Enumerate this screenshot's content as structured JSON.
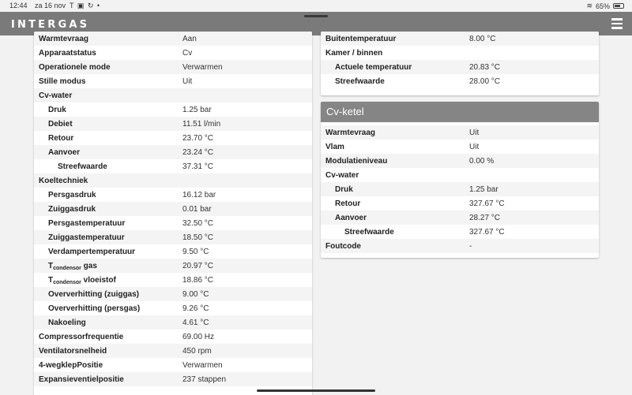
{
  "status": {
    "time": "12:44",
    "date": "za 16 nov",
    "notifications": "T ▣ ↻ •",
    "battery": "65%",
    "battery_level": 0.65
  },
  "app": {
    "logo": "INTERGAS"
  },
  "left_card": {
    "rows": [
      {
        "label": "Warmtevraag",
        "value": "Aan",
        "level": 0
      },
      {
        "label": "Apparaatstatus",
        "value": "Cv",
        "level": 0
      },
      {
        "label": "Operationele mode",
        "value": "Verwarmen",
        "level": 0
      },
      {
        "label": "Stille modus",
        "value": "Uit",
        "level": 0
      },
      {
        "label": "Cv-water",
        "value": "",
        "level": 0
      },
      {
        "label": "Druk",
        "value": "1.25 bar",
        "level": 1
      },
      {
        "label": "Debiet",
        "value": "11.51 l/min",
        "level": 1
      },
      {
        "label": "Retour",
        "value": "23.70 °C",
        "level": 1
      },
      {
        "label": "Aanvoer",
        "value": "23.24 °C",
        "level": 1
      },
      {
        "label": "Streefwaarde",
        "value": "37.31 °C",
        "level": 2
      },
      {
        "label": "Koeltechniek",
        "value": "",
        "level": 0
      },
      {
        "label": "Persgasdruk",
        "value": "16.12 bar",
        "level": 1
      },
      {
        "label": "Zuiggasdruk",
        "value": "0.01 bar",
        "level": 1
      },
      {
        "label": "Persgastemperatuur",
        "value": "32.50 °C",
        "level": 1
      },
      {
        "label": "Zuiggastemperatuur",
        "value": "18.50 °C",
        "level": 1
      },
      {
        "label": "Verdampertemperatuur",
        "value": "9.50 °C",
        "level": 1
      },
      {
        "label": "T",
        "sub": "condensor",
        "suffix": " gas",
        "value": "20.97 °C",
        "level": 1
      },
      {
        "label": "T",
        "sub": "condensor",
        "suffix": " vloeistof",
        "value": "18.86 °C",
        "level": 1
      },
      {
        "label": "Oververhitting (zuiggas)",
        "value": "9.00 °C",
        "level": 1
      },
      {
        "label": "Oververhitting (persgas)",
        "value": "9.26 °C",
        "level": 1
      },
      {
        "label": "Nakoeling",
        "value": "4.61 °C",
        "level": 1
      },
      {
        "label": "Compressorfrequentie",
        "value": "69.00 Hz",
        "level": 0
      },
      {
        "label": "Ventilatorsnelheid",
        "value": "450 rpm",
        "level": 0
      },
      {
        "label": "4-wegklepPositie",
        "value": "Verwarmen",
        "level": 0
      },
      {
        "label": "Expansieventielpositie",
        "value": "237 stappen",
        "level": 0
      }
    ]
  },
  "right_top_card": {
    "rows": [
      {
        "label": "Buitentemperatuur",
        "value": "8.00 °C",
        "level": 0
      },
      {
        "label": "Kamer / binnen",
        "value": "",
        "level": 0
      },
      {
        "label": "Actuele temperatuur",
        "value": "20.83 °C",
        "level": 1
      },
      {
        "label": "Streefwaarde",
        "value": "28.00 °C",
        "level": 1
      }
    ]
  },
  "cv_ketel_card": {
    "title": "Cv-ketel",
    "rows": [
      {
        "label": "Warmtevraag",
        "value": "Uit",
        "level": 0
      },
      {
        "label": "Vlam",
        "value": "Uit",
        "level": 0
      },
      {
        "label": "Modulatieniveau",
        "value": "0.00 %",
        "level": 0
      },
      {
        "label": "Cv-water",
        "value": "",
        "level": 0
      },
      {
        "label": "Druk",
        "value": "1.25 bar",
        "level": 1
      },
      {
        "label": "Retour",
        "value": "327.67 °C",
        "level": 1
      },
      {
        "label": "Aanvoer",
        "value": "28.27 °C",
        "level": 1
      },
      {
        "label": "Streefwaarde",
        "value": "327.67 °C",
        "level": 2
      },
      {
        "label": "Foutcode",
        "value": "-",
        "level": 0
      }
    ]
  }
}
